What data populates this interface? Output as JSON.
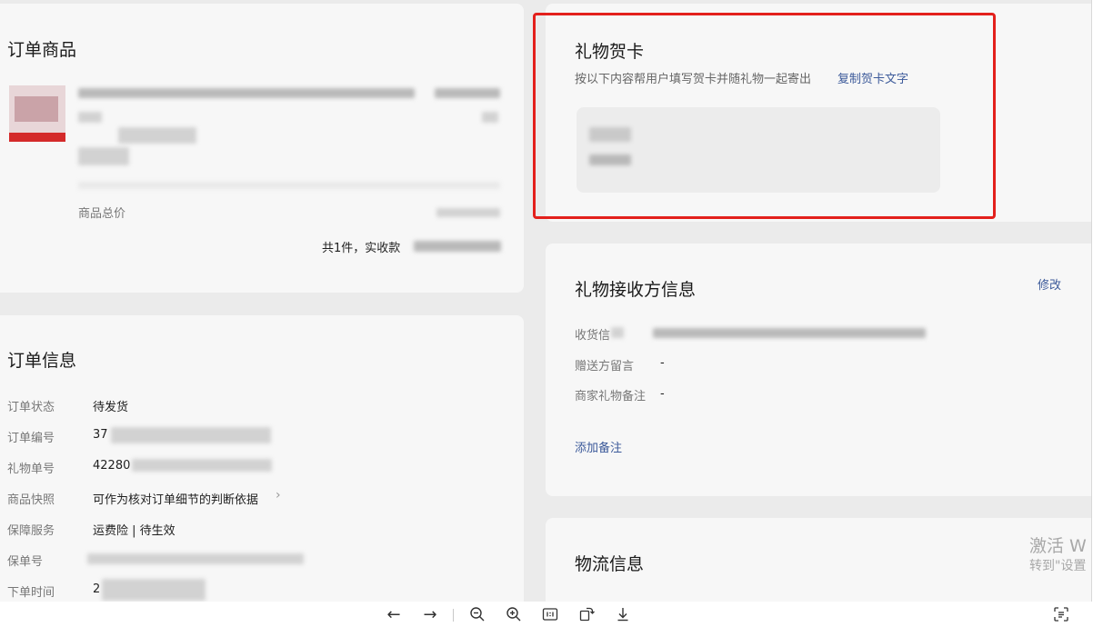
{
  "product_card": {
    "title": "订单商品",
    "total_label": "商品总价",
    "summary_text": "共1件，实收款"
  },
  "order_card": {
    "title": "订单信息",
    "rows": [
      {
        "label": "订单状态",
        "value": "待发货"
      },
      {
        "label": "订单编号",
        "value": "37"
      },
      {
        "label": "礼物单号",
        "value": "42280"
      },
      {
        "label": "商品快照",
        "value": "可作为核对订单细节的判断依据"
      },
      {
        "label": "保障服务",
        "value": "运费险 | 待生效"
      },
      {
        "label": "保单号",
        "value": ""
      },
      {
        "label": "下单时间",
        "value": "2"
      }
    ]
  },
  "gift_card": {
    "title": "礼物贺卡",
    "desc": "按以下内容帮用户填写贺卡并随礼物一起寄出",
    "copy_link": "复制贺卡文字",
    "highlight_color": "#e3201c"
  },
  "receiver_card": {
    "title": "礼物接收方信息",
    "edit_link": "修改",
    "rows": [
      {
        "label": "收货信",
        "value": ""
      },
      {
        "label": "赠送方留言",
        "value": "-"
      },
      {
        "label": "商家礼物备注",
        "value": "-"
      }
    ],
    "add_note_link": "添加备注"
  },
  "logistics_card": {
    "title": "物流信息"
  },
  "watermark": {
    "line1": "激活 W",
    "line2": "转到\"设置"
  },
  "toolbar": {
    "icons": [
      "arrow-left-icon",
      "arrow-right-icon",
      "zoom-out-icon",
      "zoom-in-icon",
      "actual-size-icon",
      "rotate-icon",
      "download-icon",
      "ocr-icon"
    ]
  }
}
